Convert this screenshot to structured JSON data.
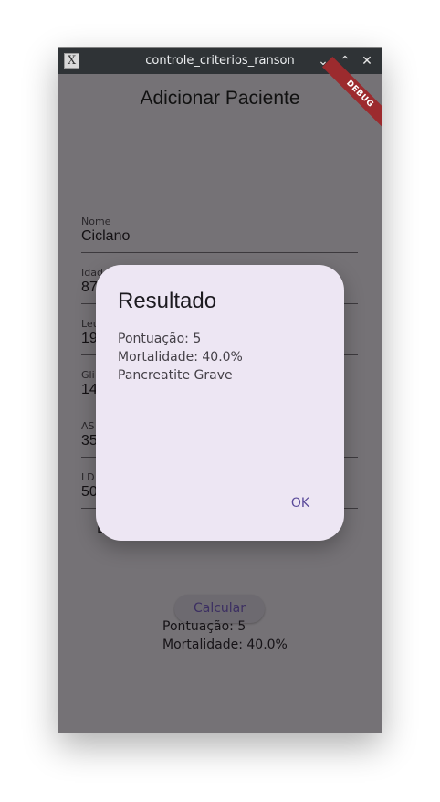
{
  "window": {
    "title": "controle_criterios_ranson",
    "icons": {
      "app": "x-app-icon",
      "minimize": "chevron-down-icon",
      "maximize": "chevron-up-icon",
      "close": "close-icon"
    },
    "app_icon_glyph": "X",
    "minimize_glyph": "⌄",
    "maximize_glyph": "⌃",
    "close_glyph": "✕"
  },
  "page": {
    "title": "Adicionar Paciente",
    "debug_banner": "DEBUG"
  },
  "form": {
    "fields": [
      {
        "label": "Nome",
        "value": "Ciclano"
      },
      {
        "label": "Idad",
        "value": "87"
      },
      {
        "label": "Leu",
        "value": "19"
      },
      {
        "label": "Gli",
        "value": "14"
      },
      {
        "label": "AS",
        "value": "35"
      },
      {
        "label": "LD",
        "value": "50"
      }
    ],
    "checkbox_label": "L",
    "calculate_button": "Calcular"
  },
  "result": {
    "score": "Pontuação: 5",
    "mortality": "Mortalidade: 40.0%"
  },
  "dialog": {
    "title": "Resultado",
    "score": "Pontuação: 5",
    "mortality": "Mortalidade: 40.0%",
    "classification": "Pancreatite Grave",
    "ok_button": "OK"
  },
  "colors": {
    "titlebar": "#2f3336",
    "scrim": "#757276",
    "dialog_bg": "#ede6f3",
    "accent": "#5a4a9a",
    "debug": "#9c2b2e"
  }
}
